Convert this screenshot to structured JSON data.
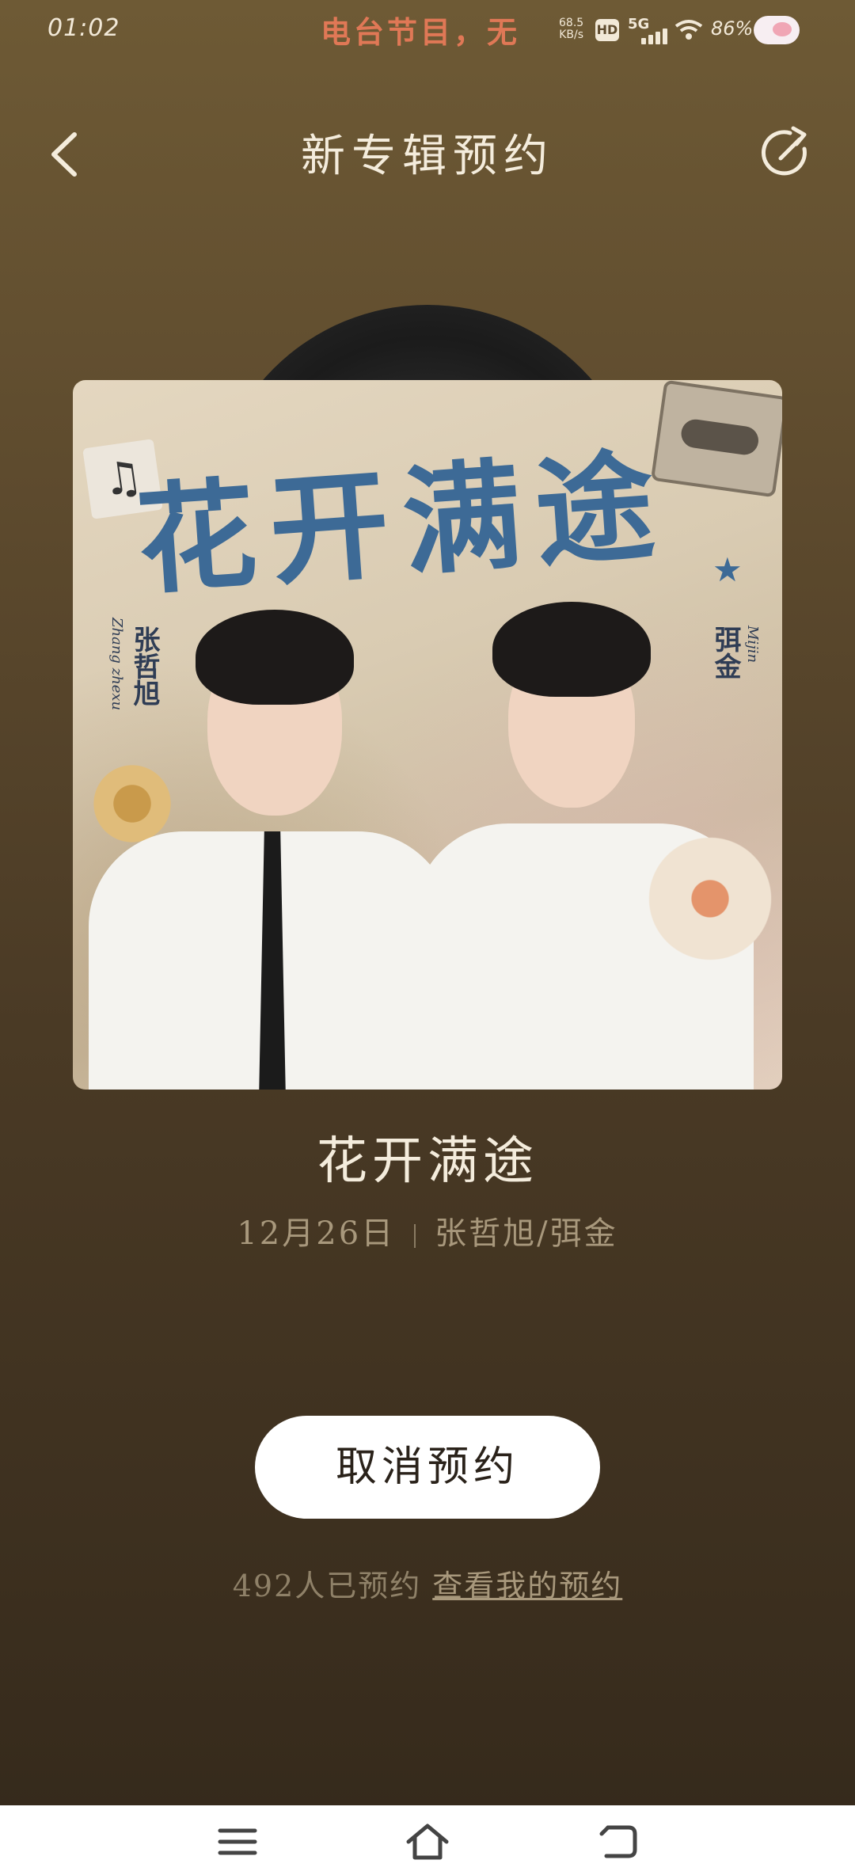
{
  "status_bar": {
    "time": "01:02",
    "ticker": "电台节目，无",
    "net_speed": "68.5",
    "net_speed_unit": "KB/s",
    "hd": "HD",
    "network": "5G",
    "battery": "86%"
  },
  "header": {
    "title": "新专辑预约"
  },
  "cover": {
    "title": "花开满途",
    "artist_left_cn": "张哲旭",
    "artist_left_en": "Zhang zhexu",
    "artist_right_cn": "弭金",
    "artist_right_en": "Mijin"
  },
  "album": {
    "title": "花开满途",
    "date": "12月26日",
    "artists": "张哲旭/弭金"
  },
  "reservation": {
    "cancel_label": "取消预约",
    "count_text": "492人已预约",
    "my_link": "查看我的预约"
  },
  "colors": {
    "bg_top": "#6e5a35",
    "bg_bottom": "#34291b",
    "title_text": "#f4ecdc",
    "meta_text": "#a8987c",
    "button_bg": "#ffffff"
  }
}
